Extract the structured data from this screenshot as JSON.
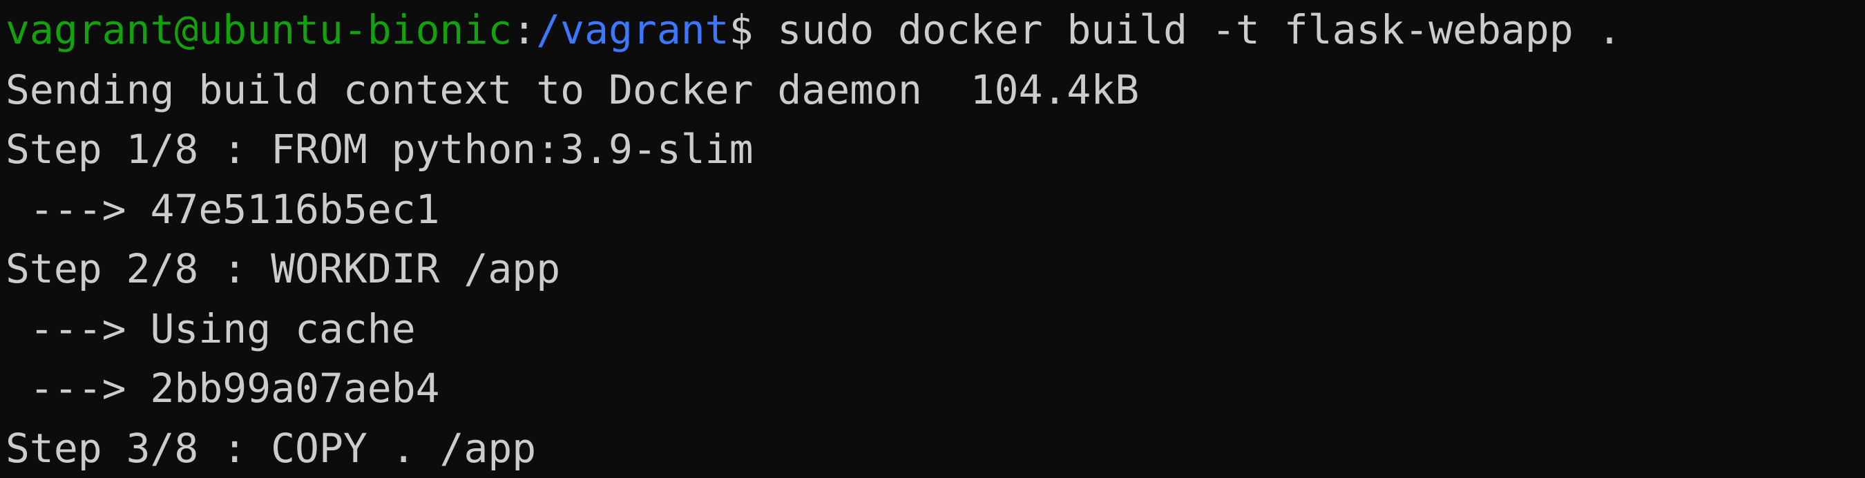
{
  "prompt": {
    "user_host": "vagrant@ubuntu-bionic",
    "separator": ":",
    "path": "/vagrant",
    "symbol": "$",
    "command": " sudo docker build -t flask-webapp ."
  },
  "output_lines": [
    "Sending build context to Docker daemon  104.4kB",
    "Step 1/8 : FROM python:3.9-slim",
    " ---> 47e5116b5ec1",
    "Step 2/8 : WORKDIR /app",
    " ---> Using cache",
    " ---> 2bb99a07aeb4",
    "Step 3/8 : COPY . /app"
  ],
  "colors": {
    "background": "#0c0c0c",
    "foreground": "#cccccc",
    "user_host": "#13a10e",
    "path": "#3b78ff"
  }
}
